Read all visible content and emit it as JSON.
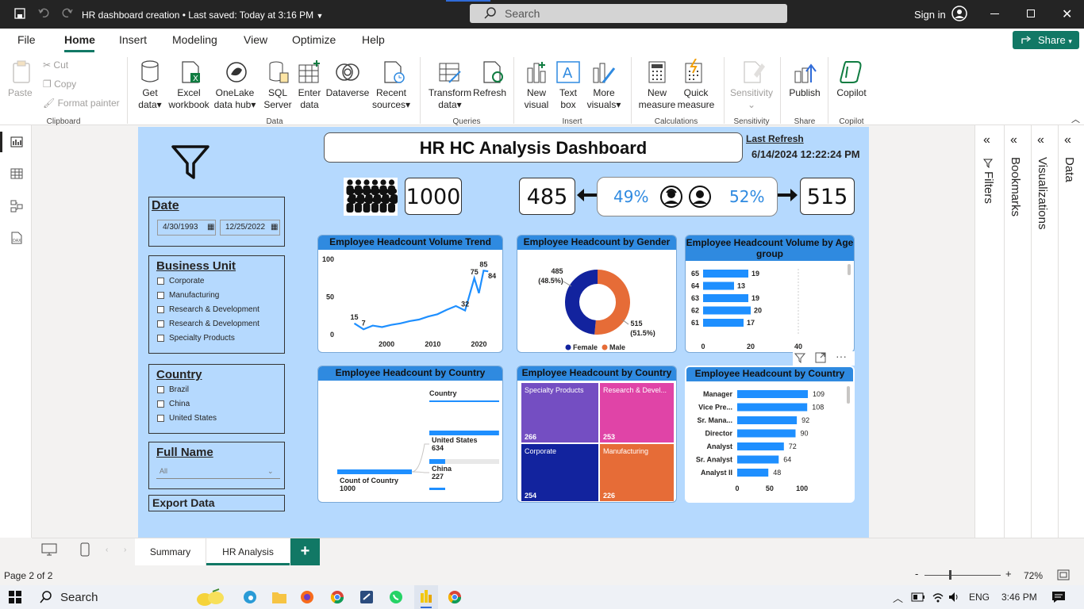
{
  "window": {
    "title": "HR dashboard creation",
    "saved": "• Last saved: Today at 3:16 PM",
    "search_placeholder": "Search",
    "sign_in": "Sign in"
  },
  "menu": [
    "File",
    "Home",
    "Insert",
    "Modeling",
    "View",
    "Optimize",
    "Help"
  ],
  "share": "Share",
  "ribbon": {
    "clipboard": {
      "paste": "Paste",
      "cut": "Cut",
      "copy": "Copy",
      "format_painter": "Format painter",
      "group": "Clipboard"
    },
    "data": {
      "get_data": [
        "Get",
        "data"
      ],
      "excel": [
        "Excel",
        "workbook"
      ],
      "onelake": [
        "OneLake",
        "data hub"
      ],
      "sql": [
        "SQL",
        "Server"
      ],
      "enter": [
        "Enter",
        "data"
      ],
      "dataverse": "Dataverse",
      "recent": [
        "Recent",
        "sources"
      ],
      "group": "Data"
    },
    "queries": {
      "transform": [
        "Transform",
        "data"
      ],
      "refresh": "Refresh",
      "group": "Queries"
    },
    "insert": {
      "new_visual": [
        "New",
        "visual"
      ],
      "text_box": [
        "Text",
        "box"
      ],
      "more_visuals": [
        "More",
        "visuals"
      ],
      "group": "Insert"
    },
    "calc": {
      "new_measure": [
        "New",
        "measure"
      ],
      "quick_measure": [
        "Quick",
        "measure"
      ],
      "group": "Calculations"
    },
    "sensitivity": {
      "label": "Sensitivity",
      "group": "Sensitivity"
    },
    "share": {
      "publish": "Publish",
      "group": "Share"
    },
    "copilot": {
      "label": "Copilot",
      "group": "Copilot"
    }
  },
  "report": {
    "title": "HR HC Analysis Dashboard",
    "last_refresh_label": "Last Refresh",
    "last_refresh_value": "6/14/2024 12:22:24 PM",
    "total": "1000",
    "female": "485",
    "female_pct": "49%",
    "male_pct": "52%",
    "male": "515",
    "date_slicer": {
      "title": "Date",
      "from": "4/30/1993",
      "to": "12/25/2022"
    },
    "bu_slicer": {
      "title": "Business Unit",
      "items": [
        "Corporate",
        "Manufacturing",
        "Research & Development",
        "Research & Development",
        "Specialty Products"
      ]
    },
    "country_slicer": {
      "title": "Country",
      "items": [
        "Brazil",
        "China",
        "United States"
      ]
    },
    "name_slicer": {
      "title": "Full Name",
      "value": "All"
    },
    "export": "Export Data"
  },
  "chart_data": [
    {
      "type": "line",
      "title": "Employee Headcount Volume Trend",
      "x": [
        1993,
        1995,
        1997,
        1999,
        2001,
        2003,
        2005,
        2007,
        2009,
        2011,
        2013,
        2015,
        2017,
        2019,
        2020,
        2021,
        2022
      ],
      "y": [
        15,
        7,
        12,
        10,
        13,
        15,
        18,
        20,
        24,
        27,
        33,
        38,
        32,
        75,
        55,
        85,
        84
      ],
      "data_labels": [
        {
          "x": 1993,
          "label": "15"
        },
        {
          "x": 1995,
          "label": "7"
        },
        {
          "x": 2017,
          "label": "32"
        },
        {
          "x": 2019,
          "label": "75"
        },
        {
          "x": 2021,
          "label": "85"
        },
        {
          "x": 2022,
          "label": "84"
        }
      ],
      "x_ticks": [
        "2000",
        "2010",
        "2020"
      ],
      "y_ticks": [
        "0",
        "50",
        "100"
      ],
      "ylim": [
        0,
        100
      ]
    },
    {
      "type": "pie",
      "title": "Employee Headcount by Gender",
      "categories": [
        "Female",
        "Male"
      ],
      "values": [
        485,
        515
      ],
      "labels": [
        "485 (48.5%)",
        "515 (51.5%)"
      ],
      "colors": [
        "#12239e",
        "#e66c37"
      ],
      "legend": "bottom"
    },
    {
      "type": "bar",
      "title": "Employee Headcount Volume by Age group",
      "categories": [
        "65",
        "64",
        "63",
        "62",
        "61"
      ],
      "values": [
        19,
        13,
        19,
        20,
        17
      ],
      "x_ticks": [
        "0",
        "20",
        "40"
      ],
      "xlim": [
        0,
        40
      ]
    },
    {
      "type": "bar",
      "title": "Employee Headcount by Country",
      "root_label": "Count of Country",
      "root_value": "1000",
      "column_header": "Country",
      "categories": [
        "United States",
        "China"
      ],
      "values": [
        634,
        227
      ]
    },
    {
      "type": "heatmap",
      "title": "Employee Headcount by Country",
      "categories": [
        "Specialty Products",
        "Research & Devel...",
        "Corporate",
        "Manufacturing"
      ],
      "values": [
        266,
        253,
        254,
        226
      ],
      "colors": [
        "#744ec2",
        "#e044a7",
        "#12239e",
        "#e66c37"
      ]
    },
    {
      "type": "bar",
      "title": "Employee Headcount by Country",
      "categories": [
        "Manager",
        "Vice Pre...",
        "Sr. Mana...",
        "Director",
        "Analyst",
        "Sr. Analyst",
        "Analyst II"
      ],
      "values": [
        109,
        108,
        92,
        90,
        72,
        64,
        48
      ],
      "x_ticks": [
        "0",
        "50",
        "100"
      ],
      "xlim": [
        0,
        120
      ]
    }
  ],
  "tabs": [
    "Summary",
    "HR Analysis"
  ],
  "status": {
    "page": "Page 2 of 2",
    "zoom": "72%"
  },
  "taskbar": {
    "search": "Search",
    "lang": "ENG",
    "time": "3:46 PM"
  },
  "panes": [
    "Filters",
    "Bookmarks",
    "Visualizations",
    "Data"
  ]
}
